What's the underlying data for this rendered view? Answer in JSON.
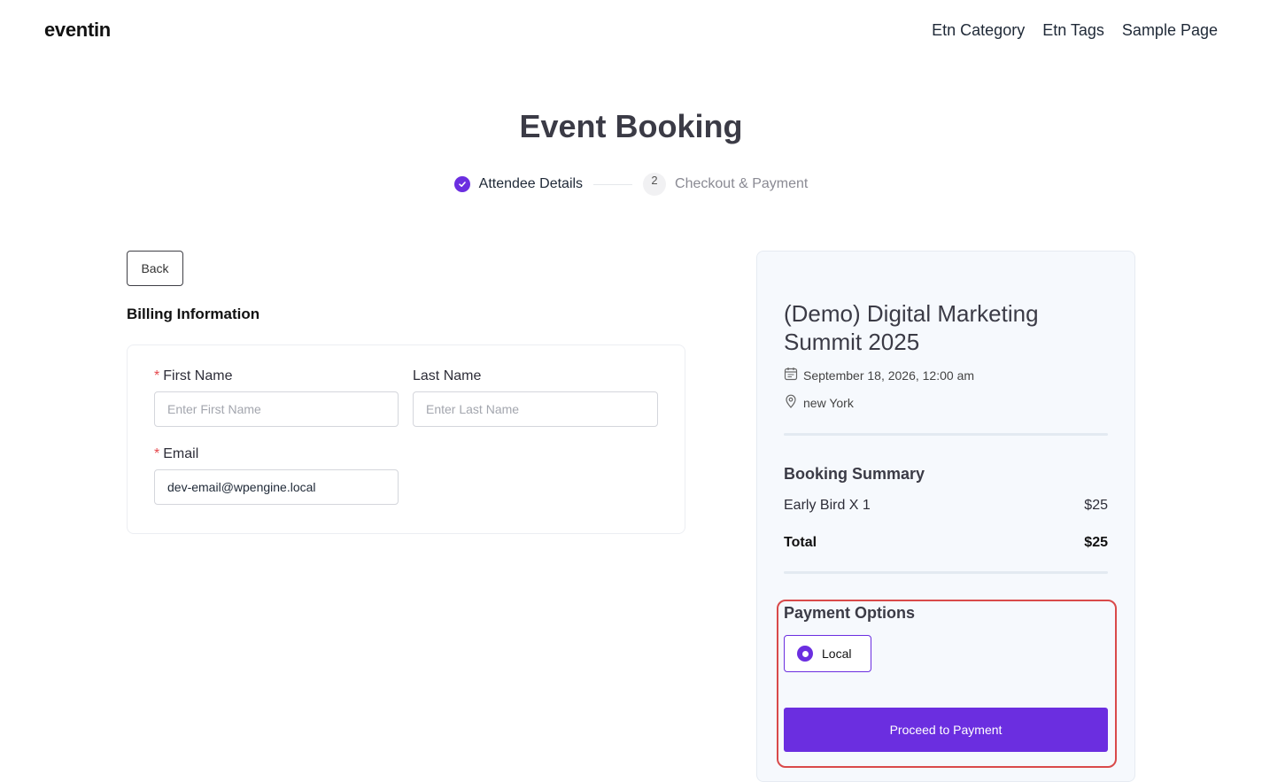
{
  "header": {
    "logo": "eventin",
    "nav": [
      "Etn Category",
      "Etn Tags",
      "Sample Page"
    ]
  },
  "page": {
    "title": "Event Booking",
    "steps": [
      {
        "label": "Attendee Details",
        "state": "done"
      },
      {
        "number": "2",
        "label": "Checkout & Payment",
        "state": "pending"
      }
    ]
  },
  "billing": {
    "back_label": "Back",
    "title": "Billing Information",
    "first_name": {
      "label": "First Name",
      "required_mark": "*",
      "placeholder": "Enter First Name",
      "value": ""
    },
    "last_name": {
      "label": "Last Name",
      "placeholder": "Enter Last Name",
      "value": ""
    },
    "email": {
      "label": "Email",
      "required_mark": "*",
      "placeholder": "",
      "value": "dev-email@wpengine.local"
    }
  },
  "summary": {
    "event_title": "(Demo) Digital Marketing Summit 2025",
    "date": "September 18, 2026, 12:00 am",
    "location": "new York",
    "title": "Booking Summary",
    "item_label": "Early Bird X 1",
    "item_price": "$25",
    "total_label": "Total",
    "total_price": "$25"
  },
  "payment": {
    "title": "Payment Options",
    "option_label": "Local",
    "proceed_label": "Proceed to Payment"
  },
  "colors": {
    "accent": "#6b2ee0",
    "highlight": "#d94a4a",
    "card_bg": "#f6f9fd"
  },
  "icons": [
    "check-icon",
    "calendar-icon",
    "location-pin-icon",
    "radio-selected-icon"
  ]
}
